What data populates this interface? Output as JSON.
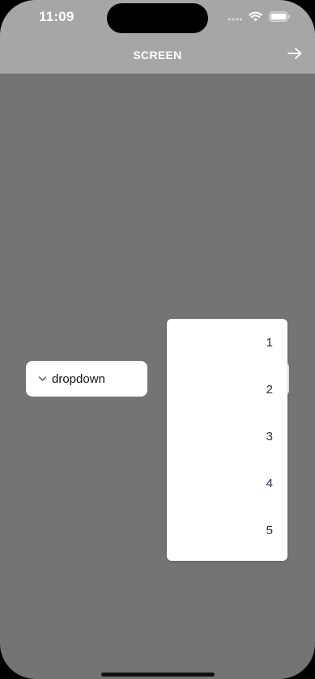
{
  "status_bar": {
    "time": "11:09",
    "icons": [
      "signal-icon",
      "wifi-icon",
      "battery-icon"
    ]
  },
  "header": {
    "title": "SCREEN",
    "action_icon": "arrow-right-icon"
  },
  "dropdown": {
    "label": "dropdown",
    "icon": "chevron-down-icon",
    "options": [
      "1",
      "2",
      "3",
      "4",
      "5"
    ]
  },
  "colors": {
    "overlay_bg": "#747474",
    "header_bg": "#a5a6a7",
    "menu_bg": "#ffffff",
    "menu_text": "#1f2a44"
  }
}
